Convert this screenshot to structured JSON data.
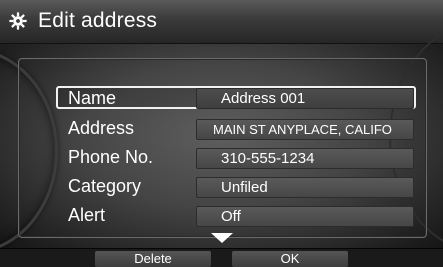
{
  "header": {
    "title": "Edit address",
    "icon": "gear-icon"
  },
  "fields": [
    {
      "label": "Name",
      "value": "Address 001",
      "selected": true
    },
    {
      "label": "Address",
      "value": "MAIN ST ANYPLACE, CALIFO"
    },
    {
      "label": "Phone No.",
      "value": "310-555-1234"
    },
    {
      "label": "Category",
      "value": "Unfiled"
    },
    {
      "label": "Alert",
      "value": "Off"
    }
  ],
  "softkeys": {
    "delete_label": "Delete",
    "ok_label": "OK"
  },
  "colors": {
    "text": "#ffffff",
    "selection_border": "#f2f2f2",
    "value_box": "#4f4f4f"
  }
}
